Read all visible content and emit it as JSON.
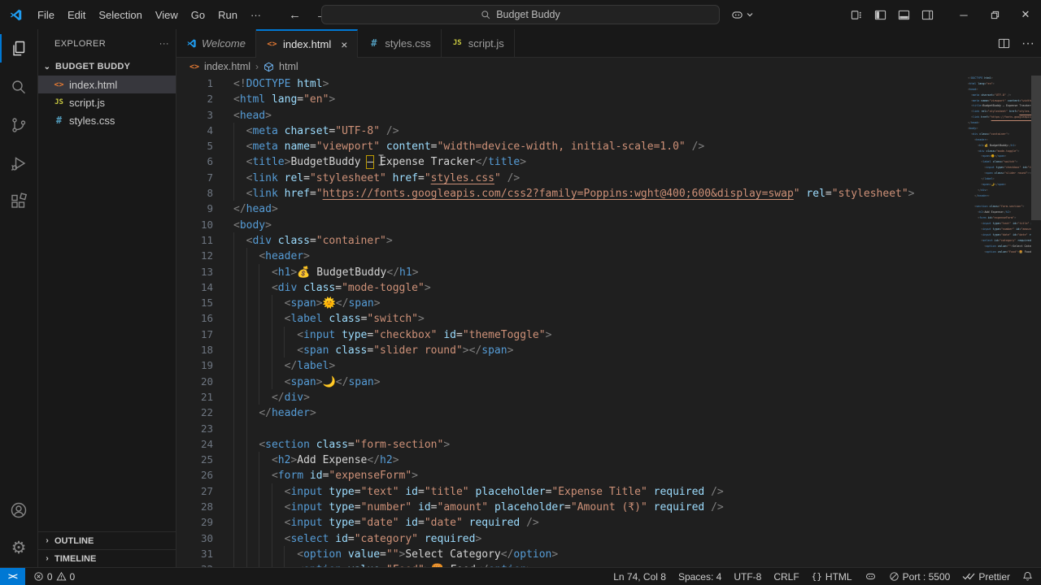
{
  "colors": {
    "accent": "#0078d4",
    "titlebar_bg": "#181818",
    "editor_bg": "#1f1f1f",
    "tag": "#569cd6",
    "attribute": "#9cdcfe",
    "string": "#ce9178",
    "punctuation": "#808080",
    "text": "#d4d4d4",
    "unicode_highlight_border": "#bd9b03",
    "html_icon": "#e37933",
    "js_icon": "#cbcb41",
    "css_icon": "#519aba"
  },
  "title_bar": {
    "menus": [
      "File",
      "Edit",
      "Selection",
      "View",
      "Go",
      "Run"
    ],
    "more_menus": "···",
    "back_arrow": "←",
    "forward_arrow": "→",
    "search_text": "Budget Buddy",
    "icons": [
      "vscode-logo-icon",
      "search-icon",
      "copilot-icon",
      "customize-layout-icon",
      "toggle-primary-sidebar-icon",
      "toggle-panel-icon",
      "toggle-secondary-sidebar-icon",
      "minimize-icon",
      "restore-icon",
      "close-icon"
    ],
    "minimize": "─",
    "close": "✕"
  },
  "activity_bar": {
    "top": [
      "explorer-icon",
      "search-icon",
      "source-control-icon",
      "run-debug-icon",
      "extensions-icon"
    ],
    "bottom": [
      "account-icon",
      "settings-gear-icon"
    ],
    "active": "explorer-icon",
    "gear_glyph": "⚙"
  },
  "sidebar": {
    "header": "EXPLORER",
    "more": "···",
    "project": "BUDGET BUDDY",
    "project_chevron": "⌄",
    "files": [
      {
        "name": "index.html",
        "icon": "html",
        "glyph": "<>",
        "selected": true
      },
      {
        "name": "script.js",
        "icon": "js",
        "glyph": "JS",
        "selected": false
      },
      {
        "name": "styles.css",
        "icon": "css",
        "glyph": "#",
        "selected": false
      }
    ],
    "sections": [
      {
        "label": "OUTLINE",
        "chevron": "›"
      },
      {
        "label": "TIMELINE",
        "chevron": "›"
      }
    ]
  },
  "tabs": [
    {
      "label": "Welcome",
      "icon": "vscode",
      "preview": true,
      "active": false,
      "close": ""
    },
    {
      "label": "index.html",
      "icon": "html",
      "preview": false,
      "active": true,
      "close": "×"
    },
    {
      "label": "styles.css",
      "icon": "css",
      "preview": false,
      "active": false,
      "close": ""
    },
    {
      "label": "script.js",
      "icon": "js",
      "preview": false,
      "active": false,
      "close": ""
    }
  ],
  "breadcrumb": {
    "file": "index.html",
    "separator": "›",
    "symbol": "html",
    "file_glyph": "<>"
  },
  "editor": {
    "lines": [
      {
        "tokens": [
          [
            "p",
            "<!"
          ],
          [
            "t",
            "DOCTYPE"
          ],
          [
            "a",
            " html"
          ],
          [
            "p",
            ">"
          ]
        ]
      },
      {
        "tokens": [
          [
            "p",
            "<"
          ],
          [
            "t",
            "html"
          ],
          [
            "a",
            " lang"
          ],
          [
            "o",
            "="
          ],
          [
            "s",
            "\"en\""
          ],
          [
            "p",
            ">"
          ]
        ]
      },
      {
        "tokens": [
          [
            "p",
            "<"
          ],
          [
            "t",
            "head"
          ],
          [
            "p",
            ">"
          ]
        ]
      },
      {
        "tokens": [
          [
            "w",
            "  "
          ],
          [
            "p",
            "<"
          ],
          [
            "t",
            "meta"
          ],
          [
            "a",
            " charset"
          ],
          [
            "o",
            "="
          ],
          [
            "s",
            "\"UTF-8\""
          ],
          [
            "p",
            " />"
          ]
        ]
      },
      {
        "tokens": [
          [
            "w",
            "  "
          ],
          [
            "p",
            "<"
          ],
          [
            "t",
            "meta"
          ],
          [
            "a",
            " name"
          ],
          [
            "o",
            "="
          ],
          [
            "s",
            "\"viewport\""
          ],
          [
            "a",
            " content"
          ],
          [
            "o",
            "="
          ],
          [
            "s",
            "\"width=device-width, initial-scale=1.0\""
          ],
          [
            "p",
            " />"
          ]
        ]
      },
      {
        "tokens": [
          [
            "w",
            "  "
          ],
          [
            "p",
            "<"
          ],
          [
            "t",
            "title"
          ],
          [
            "p",
            ">"
          ],
          [
            "x",
            "BudgetBuddy "
          ],
          [
            "b",
            "–"
          ],
          [
            "x",
            " Expense Tracker"
          ],
          [
            "p",
            "</"
          ],
          [
            "t",
            "title"
          ],
          [
            "p",
            ">"
          ]
        ]
      },
      {
        "tokens": [
          [
            "w",
            "  "
          ],
          [
            "p",
            "<"
          ],
          [
            "t",
            "link"
          ],
          [
            "a",
            " rel"
          ],
          [
            "o",
            "="
          ],
          [
            "s",
            "\"stylesheet\""
          ],
          [
            "a",
            " href"
          ],
          [
            "o",
            "="
          ],
          [
            "s",
            "\""
          ],
          [
            "l",
            "styles.css"
          ],
          [
            "s",
            "\""
          ],
          [
            "p",
            " />"
          ]
        ]
      },
      {
        "tokens": [
          [
            "w",
            "  "
          ],
          [
            "p",
            "<"
          ],
          [
            "t",
            "link"
          ],
          [
            "a",
            " href"
          ],
          [
            "o",
            "="
          ],
          [
            "s",
            "\""
          ],
          [
            "l",
            "https://fonts.googleapis.com/css2?family=Poppins:wght@400;600&display=swap"
          ],
          [
            "s",
            "\""
          ],
          [
            "a",
            " rel"
          ],
          [
            "o",
            "="
          ],
          [
            "s",
            "\"stylesheet\""
          ],
          [
            "p",
            ">"
          ]
        ]
      },
      {
        "tokens": [
          [
            "p",
            "</"
          ],
          [
            "t",
            "head"
          ],
          [
            "p",
            ">"
          ]
        ]
      },
      {
        "tokens": [
          [
            "p",
            "<"
          ],
          [
            "t",
            "body"
          ],
          [
            "p",
            ">"
          ]
        ]
      },
      {
        "tokens": [
          [
            "w",
            "  "
          ],
          [
            "p",
            "<"
          ],
          [
            "t",
            "div"
          ],
          [
            "a",
            " class"
          ],
          [
            "o",
            "="
          ],
          [
            "s",
            "\"container\""
          ],
          [
            "p",
            ">"
          ]
        ]
      },
      {
        "tokens": [
          [
            "w",
            "    "
          ],
          [
            "p",
            "<"
          ],
          [
            "t",
            "header"
          ],
          [
            "p",
            ">"
          ]
        ]
      },
      {
        "tokens": [
          [
            "w",
            "      "
          ],
          [
            "p",
            "<"
          ],
          [
            "t",
            "h1"
          ],
          [
            "p",
            ">"
          ],
          [
            "x",
            "💰 BudgetBuddy"
          ],
          [
            "p",
            "</"
          ],
          [
            "t",
            "h1"
          ],
          [
            "p",
            ">"
          ]
        ]
      },
      {
        "tokens": [
          [
            "w",
            "      "
          ],
          [
            "p",
            "<"
          ],
          [
            "t",
            "div"
          ],
          [
            "a",
            " class"
          ],
          [
            "o",
            "="
          ],
          [
            "s",
            "\"mode-toggle\""
          ],
          [
            "p",
            ">"
          ]
        ]
      },
      {
        "tokens": [
          [
            "w",
            "        "
          ],
          [
            "p",
            "<"
          ],
          [
            "t",
            "span"
          ],
          [
            "p",
            ">"
          ],
          [
            "x",
            "🌞"
          ],
          [
            "p",
            "</"
          ],
          [
            "t",
            "span"
          ],
          [
            "p",
            ">"
          ]
        ]
      },
      {
        "tokens": [
          [
            "w",
            "        "
          ],
          [
            "p",
            "<"
          ],
          [
            "t",
            "label"
          ],
          [
            "a",
            " class"
          ],
          [
            "o",
            "="
          ],
          [
            "s",
            "\"switch\""
          ],
          [
            "p",
            ">"
          ]
        ]
      },
      {
        "tokens": [
          [
            "w",
            "          "
          ],
          [
            "p",
            "<"
          ],
          [
            "t",
            "input"
          ],
          [
            "a",
            " type"
          ],
          [
            "o",
            "="
          ],
          [
            "s",
            "\"checkbox\""
          ],
          [
            "a",
            " id"
          ],
          [
            "o",
            "="
          ],
          [
            "s",
            "\"themeToggle\""
          ],
          [
            "p",
            ">"
          ]
        ]
      },
      {
        "tokens": [
          [
            "w",
            "          "
          ],
          [
            "p",
            "<"
          ],
          [
            "t",
            "span"
          ],
          [
            "a",
            " class"
          ],
          [
            "o",
            "="
          ],
          [
            "s",
            "\"slider round\""
          ],
          [
            "p",
            ">"
          ],
          [
            "p",
            "</"
          ],
          [
            "t",
            "span"
          ],
          [
            "p",
            ">"
          ]
        ]
      },
      {
        "tokens": [
          [
            "w",
            "        "
          ],
          [
            "p",
            "</"
          ],
          [
            "t",
            "label"
          ],
          [
            "p",
            ">"
          ]
        ]
      },
      {
        "tokens": [
          [
            "w",
            "        "
          ],
          [
            "p",
            "<"
          ],
          [
            "t",
            "span"
          ],
          [
            "p",
            ">"
          ],
          [
            "x",
            "🌙"
          ],
          [
            "p",
            "</"
          ],
          [
            "t",
            "span"
          ],
          [
            "p",
            ">"
          ]
        ]
      },
      {
        "tokens": [
          [
            "w",
            "      "
          ],
          [
            "p",
            "</"
          ],
          [
            "t",
            "div"
          ],
          [
            "p",
            ">"
          ]
        ]
      },
      {
        "tokens": [
          [
            "w",
            "    "
          ],
          [
            "p",
            "</"
          ],
          [
            "t",
            "header"
          ],
          [
            "p",
            ">"
          ]
        ]
      },
      {
        "ind": 4,
        "tokens": []
      },
      {
        "tokens": [
          [
            "w",
            "    "
          ],
          [
            "p",
            "<"
          ],
          [
            "t",
            "section"
          ],
          [
            "a",
            " class"
          ],
          [
            "o",
            "="
          ],
          [
            "s",
            "\"form-section\""
          ],
          [
            "p",
            ">"
          ]
        ]
      },
      {
        "tokens": [
          [
            "w",
            "      "
          ],
          [
            "p",
            "<"
          ],
          [
            "t",
            "h2"
          ],
          [
            "p",
            ">"
          ],
          [
            "x",
            "Add Expense"
          ],
          [
            "p",
            "</"
          ],
          [
            "t",
            "h2"
          ],
          [
            "p",
            ">"
          ]
        ]
      },
      {
        "tokens": [
          [
            "w",
            "      "
          ],
          [
            "p",
            "<"
          ],
          [
            "t",
            "form"
          ],
          [
            "a",
            " id"
          ],
          [
            "o",
            "="
          ],
          [
            "s",
            "\"expenseForm\""
          ],
          [
            "p",
            ">"
          ]
        ]
      },
      {
        "tokens": [
          [
            "w",
            "        "
          ],
          [
            "p",
            "<"
          ],
          [
            "t",
            "input"
          ],
          [
            "a",
            " type"
          ],
          [
            "o",
            "="
          ],
          [
            "s",
            "\"text\""
          ],
          [
            "a",
            " id"
          ],
          [
            "o",
            "="
          ],
          [
            "s",
            "\"title\""
          ],
          [
            "a",
            " placeholder"
          ],
          [
            "o",
            "="
          ],
          [
            "s",
            "\"Expense Title\""
          ],
          [
            "a",
            " required"
          ],
          [
            "p",
            " />"
          ]
        ]
      },
      {
        "tokens": [
          [
            "w",
            "        "
          ],
          [
            "p",
            "<"
          ],
          [
            "t",
            "input"
          ],
          [
            "a",
            " type"
          ],
          [
            "o",
            "="
          ],
          [
            "s",
            "\"number\""
          ],
          [
            "a",
            " id"
          ],
          [
            "o",
            "="
          ],
          [
            "s",
            "\"amount\""
          ],
          [
            "a",
            " placeholder"
          ],
          [
            "o",
            "="
          ],
          [
            "s",
            "\"Amount (₹)\""
          ],
          [
            "a",
            " required"
          ],
          [
            "p",
            " />"
          ]
        ]
      },
      {
        "tokens": [
          [
            "w",
            "        "
          ],
          [
            "p",
            "<"
          ],
          [
            "t",
            "input"
          ],
          [
            "a",
            " type"
          ],
          [
            "o",
            "="
          ],
          [
            "s",
            "\"date\""
          ],
          [
            "a",
            " id"
          ],
          [
            "o",
            "="
          ],
          [
            "s",
            "\"date\""
          ],
          [
            "a",
            " required"
          ],
          [
            "p",
            " />"
          ]
        ]
      },
      {
        "tokens": [
          [
            "w",
            "        "
          ],
          [
            "p",
            "<"
          ],
          [
            "t",
            "select"
          ],
          [
            "a",
            " id"
          ],
          [
            "o",
            "="
          ],
          [
            "s",
            "\"category\""
          ],
          [
            "a",
            " required"
          ],
          [
            "p",
            ">"
          ]
        ]
      },
      {
        "tokens": [
          [
            "w",
            "          "
          ],
          [
            "p",
            "<"
          ],
          [
            "t",
            "option"
          ],
          [
            "a",
            " value"
          ],
          [
            "o",
            "="
          ],
          [
            "s",
            "\"\""
          ],
          [
            "p",
            ">"
          ],
          [
            "x",
            "Select Category"
          ],
          [
            "p",
            "</"
          ],
          [
            "t",
            "option"
          ],
          [
            "p",
            ">"
          ]
        ]
      },
      {
        "tokens": [
          [
            "w",
            "          "
          ],
          [
            "p",
            "<"
          ],
          [
            "t",
            "option"
          ],
          [
            "a",
            " value"
          ],
          [
            "o",
            "="
          ],
          [
            "s",
            "\"Food\""
          ],
          [
            "p",
            ">"
          ],
          [
            "x",
            "🍔 Food"
          ],
          [
            "p",
            "</"
          ],
          [
            "t",
            "option"
          ],
          [
            "p",
            ">"
          ]
        ]
      }
    ]
  },
  "status_bar": {
    "remote_glyph": "><",
    "errors": "0",
    "warnings": "0",
    "right": [
      {
        "icon": "",
        "label": "Ln 74, Col 8"
      },
      {
        "icon": "",
        "label": "Spaces: 4"
      },
      {
        "icon": "",
        "label": "UTF-8"
      },
      {
        "icon": "",
        "label": "CRLF"
      },
      {
        "icon": "braces-icon",
        "label": "HTML"
      },
      {
        "icon": "copilot-icon",
        "label": ""
      },
      {
        "icon": "circle-slash-icon",
        "label": "Port : 5500"
      },
      {
        "icon": "double-check-icon",
        "label": "Prettier"
      },
      {
        "icon": "bell-icon",
        "label": ""
      }
    ]
  }
}
